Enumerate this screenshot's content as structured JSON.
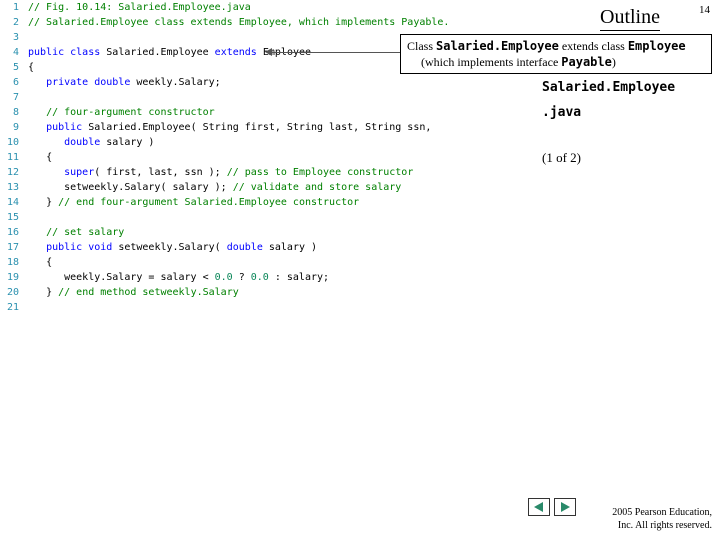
{
  "header": {
    "outline_label": "Outline",
    "page_number": "14"
  },
  "callout": {
    "line1_a": "Class ",
    "line1_b": "Salaried.Employee",
    "line1_c": " extends class ",
    "line1_d": "Employee",
    "line2_a": "(which implements interface ",
    "line2_b": "Payable",
    "line2_c": ")"
  },
  "side": {
    "title1": "Salaried.Employee",
    "title2": ".java",
    "pageinfo": "(1 of  2)"
  },
  "footer": {
    "copyright_line1": "  2005 Pearson Education,",
    "copyright_line2": "Inc.  All rights reserved."
  },
  "code": {
    "lines": [
      {
        "n": "1",
        "html": "<span class='c-comment'>// Fig. 10.14: Salaried.Employee.java</span>"
      },
      {
        "n": "2",
        "html": "<span class='c-comment'>// Salaried.Employee class extends Employee, which implements Payable.</span>"
      },
      {
        "n": "3",
        "html": ""
      },
      {
        "n": "4",
        "html": "<span class='c-kw'>public class</span> <span class='c-plain'>Salaried.Employee</span> <span class='c-kw'>extends</span> <span class='c-plain'>Employee</span>"
      },
      {
        "n": "5",
        "html": "<span class='c-plain'>{</span>"
      },
      {
        "n": "6",
        "html": "   <span class='c-kw'>private double</span> <span class='c-plain'>weekly.Salary;</span>"
      },
      {
        "n": "7",
        "html": ""
      },
      {
        "n": "8",
        "html": "   <span class='c-comment'>// four-argument constructor</span>"
      },
      {
        "n": "9",
        "html": "   <span class='c-kw'>public</span> <span class='c-plain'>Salaried.Employee( String first, String last, String ssn,</span>"
      },
      {
        "n": "10",
        "html": "      <span class='c-kw'>double</span> <span class='c-plain'>salary )</span>"
      },
      {
        "n": "11",
        "html": "   <span class='c-plain'>{</span>"
      },
      {
        "n": "12",
        "html": "      <span class='c-kw'>super</span><span class='c-plain'>( first, last, ssn );</span> <span class='c-comment'>// pass to Employee constructor</span>"
      },
      {
        "n": "13",
        "html": "      <span class='c-plain'>setweekly.Salary( salary );</span> <span class='c-comment'>// validate and store salary</span>"
      },
      {
        "n": "14",
        "html": "   <span class='c-plain'>}</span> <span class='c-comment'>// end four-argument Salaried.Employee constructor</span>"
      },
      {
        "n": "15",
        "html": ""
      },
      {
        "n": "16",
        "html": "   <span class='c-comment'>// set salary</span>"
      },
      {
        "n": "17",
        "html": "   <span class='c-kw'>public void</span> <span class='c-plain'>setweekly.Salary(</span> <span class='c-kw'>double</span> <span class='c-plain'>salary )</span>"
      },
      {
        "n": "18",
        "html": "   <span class='c-plain'>{</span>"
      },
      {
        "n": "19",
        "html": "      <span class='c-plain'>weekly.Salary = salary &lt; </span><span class='c-num'>0.0</span><span class='c-plain'> ? </span><span class='c-num'>0.0</span><span class='c-plain'> : salary;</span>"
      },
      {
        "n": "20",
        "html": "   <span class='c-plain'>}</span> <span class='c-comment'>// end method setweekly.Salary</span>"
      },
      {
        "n": "21",
        "html": ""
      }
    ]
  }
}
